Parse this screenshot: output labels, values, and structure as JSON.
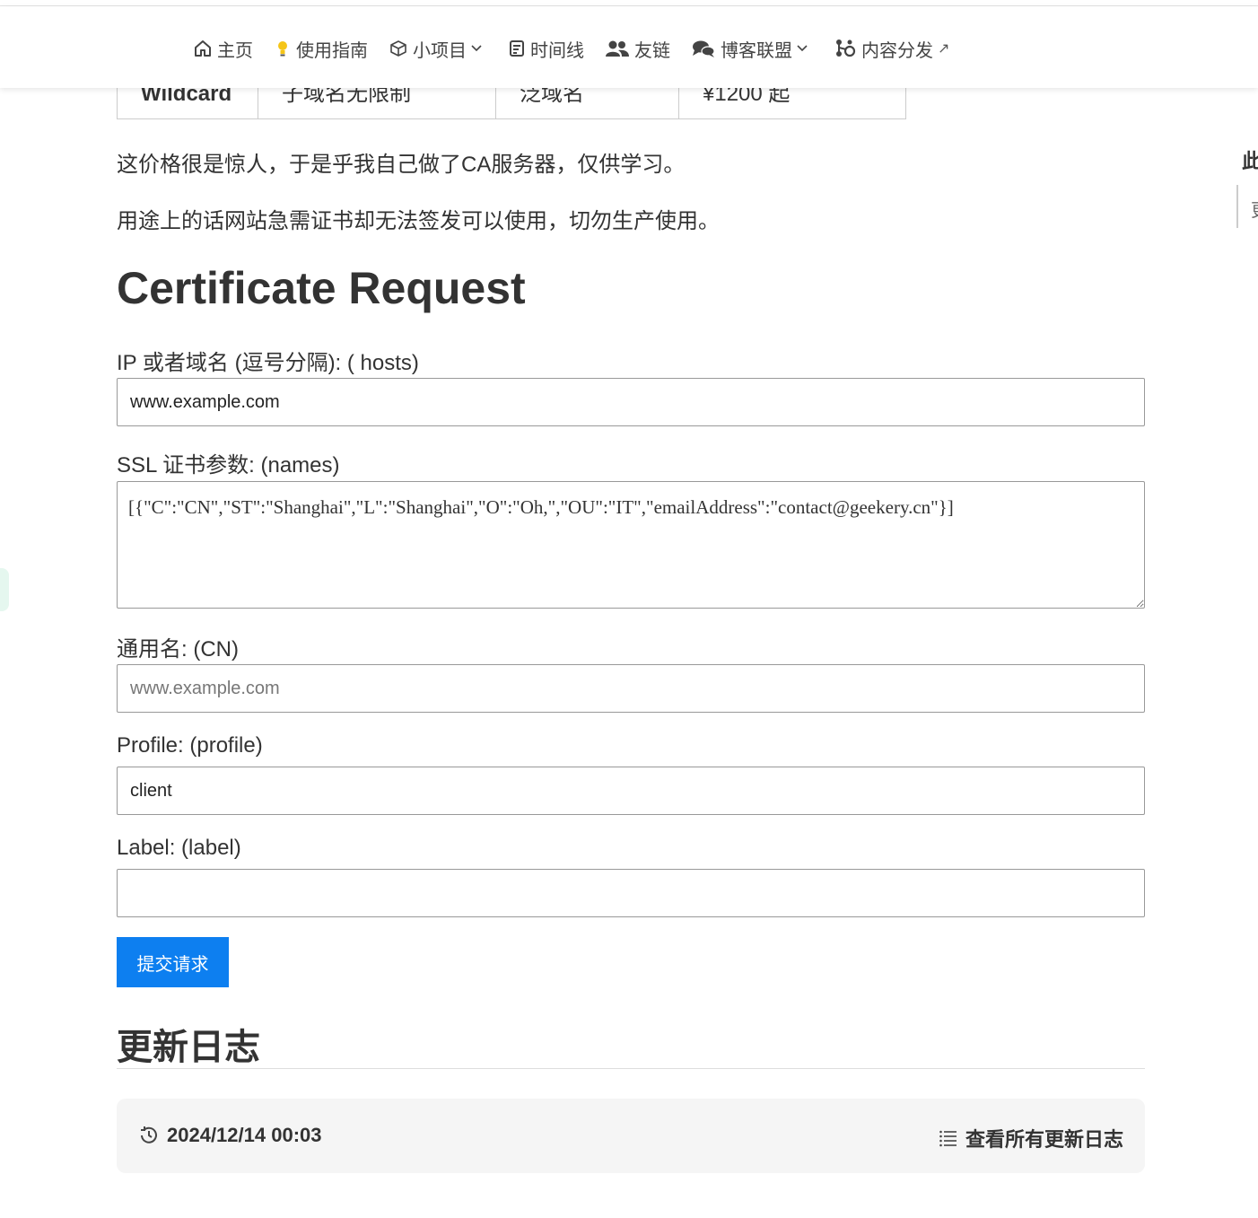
{
  "nav": {
    "home": "主页",
    "guide": "使用指南",
    "projects": "小项目",
    "timeline": "时间线",
    "friends": "友链",
    "blog_union": "博客联盟",
    "distribution": "内容分发"
  },
  "table": {
    "type": "Wildcard",
    "domains": "子域名无限制",
    "kind": "泛域名",
    "price": "¥1200 起"
  },
  "paragraphs": {
    "p1": "这价格很是惊人，于是乎我自己做了CA服务器，仅供学习。",
    "p2": "用途上的话网站急需证书却无法签发可以使用，切勿生产使用。"
  },
  "form": {
    "title": "Certificate Request",
    "hosts_label": "IP 或者域名 (逗号分隔): ( hosts)",
    "hosts_value": "www.example.com",
    "names_label": "SSL 证书参数: (names)",
    "names_value": "[{\"C\":\"CN\",\"ST\":\"Shanghai\",\"L\":\"Shanghai\",\"O\":\"Oh,\",\"OU\":\"IT\",\"emailAddress\":\"contact@geekery.cn\"}]",
    "cn_label": "通用名: (CN)",
    "cn_placeholder": "www.example.com",
    "profile_label": "Profile: (profile)",
    "profile_value": "client",
    "label_label": "Label: (label)",
    "label_value": "",
    "submit": "提交请求"
  },
  "changelog": {
    "title": "更新日志",
    "date": "2024/12/14 00:03",
    "view_all": "查看所有更新日志"
  },
  "sidebar": {
    "title": "此",
    "item": "更"
  },
  "colors": {
    "primary": "#0d7ff0",
    "text": "#333333",
    "log_bg": "#f5f5f5"
  }
}
